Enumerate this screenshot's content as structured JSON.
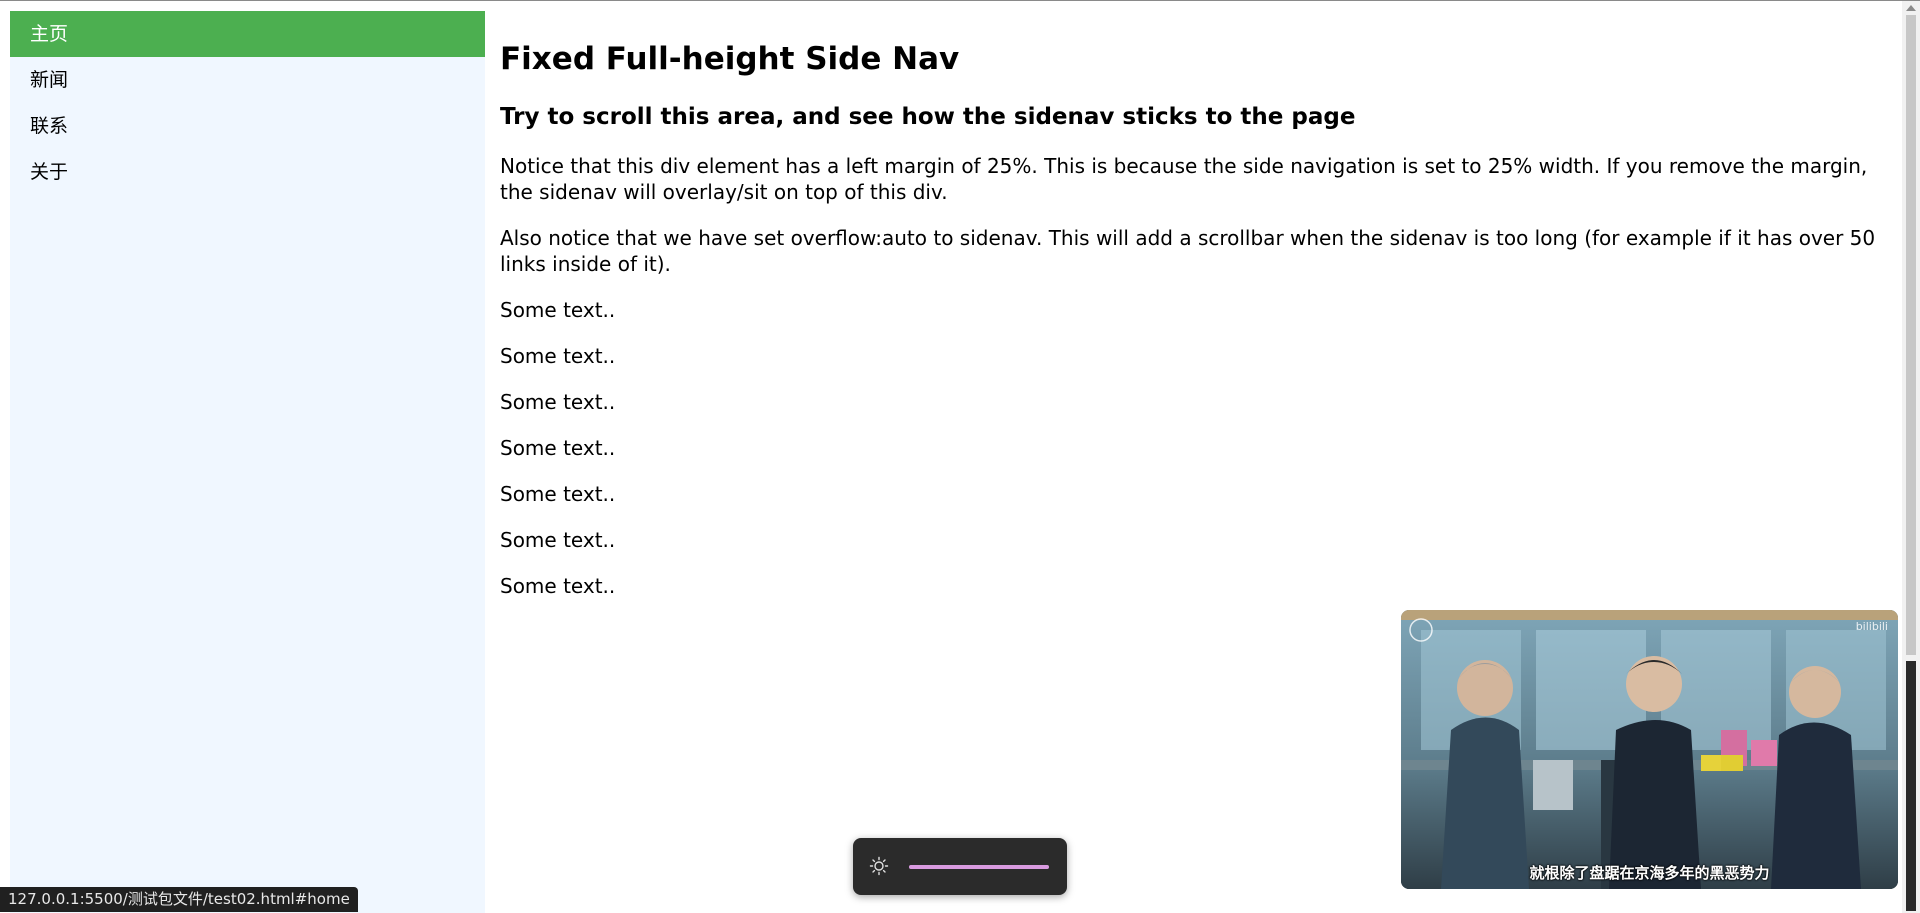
{
  "sidenav": {
    "items": [
      {
        "label": "主页",
        "active": true
      },
      {
        "label": "新闻",
        "active": false
      },
      {
        "label": "联系",
        "active": false
      },
      {
        "label": "关于",
        "active": false
      }
    ],
    "active_color": "#4caf50",
    "background_color": "#f0f7ff"
  },
  "main": {
    "heading": "Fixed Full-height Side Nav",
    "subheading": "Try to scroll this area, and see how the sidenav sticks to the page",
    "paragraph1": "Notice that this div element has a left margin of 25%. This is because the side navigation is set to 25% width. If you remove the margin, the sidenav will overlay/sit on top of this div.",
    "paragraph2": "Also notice that we have set overflow:auto to sidenav. This will add a scrollbar when the sidenav is too long (for example if it has over 50 links inside of it).",
    "some_text": [
      "Some text..",
      "Some text..",
      "Some text..",
      "Some text..",
      "Some text..",
      "Some text..",
      "Some text.."
    ]
  },
  "status_bar": {
    "url": "127.0.0.1:5500/测试包文件/test02.html#home"
  },
  "video_pip": {
    "subtitle": "就根除了盘踞在京海多年的黑恶势力"
  },
  "brightness": {
    "icon": "sun-icon",
    "level": 1.0,
    "accent_color": "#d99be0"
  }
}
